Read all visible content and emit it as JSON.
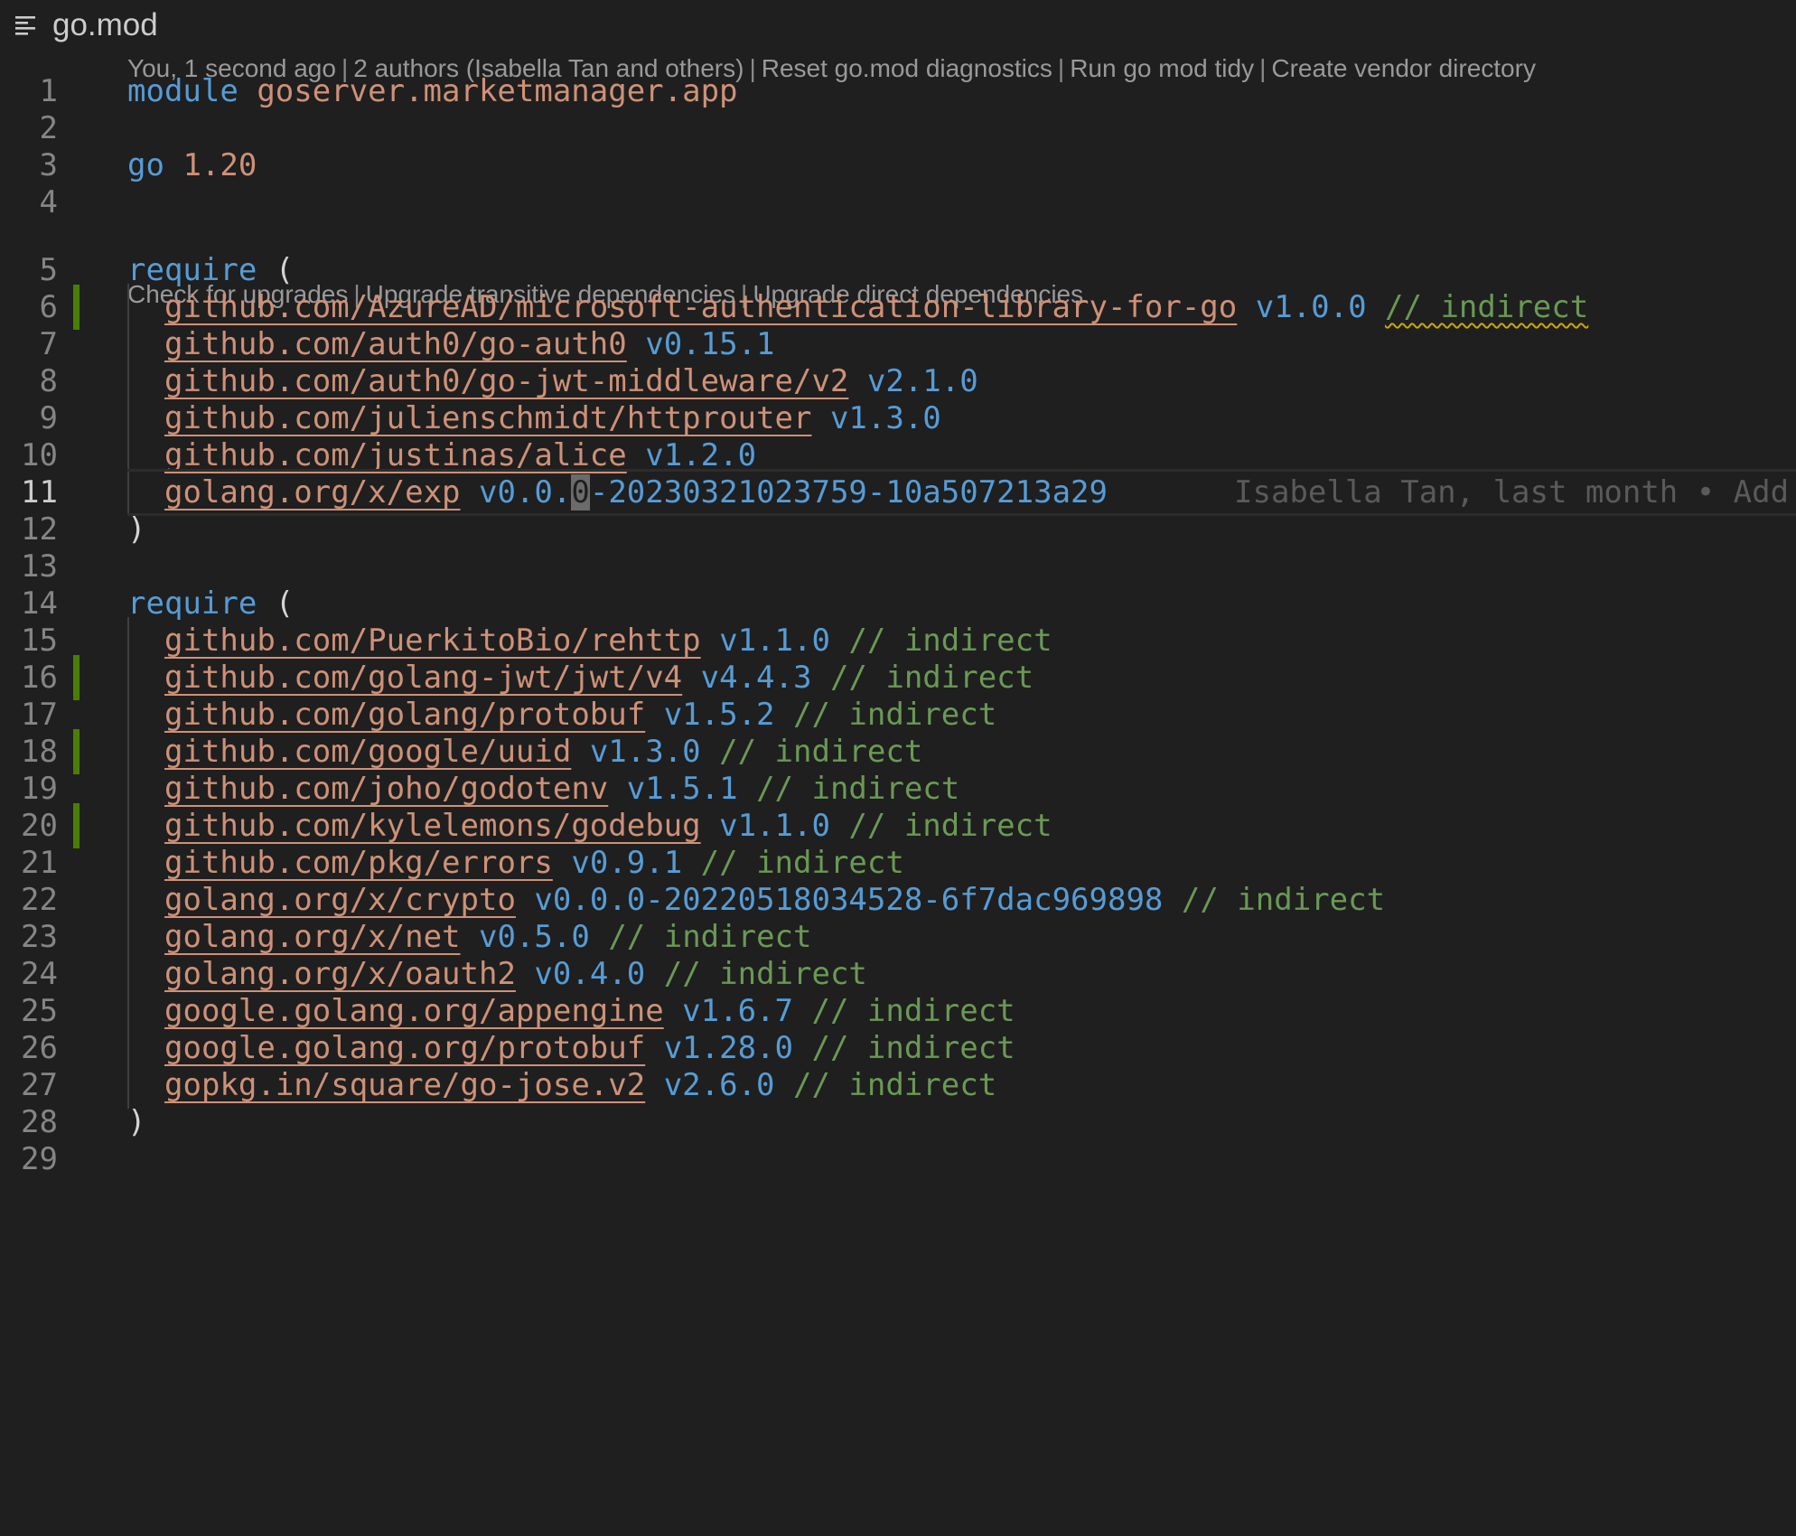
{
  "breadcrumb": {
    "icon": "list-outline-icon",
    "title": "go.mod"
  },
  "codelens": {
    "top": {
      "author": "You, 1 second ago",
      "authors": "2 authors (Isabella Tan and others)",
      "actions": [
        "Reset go.mod diagnostics",
        "Run go mod tidy",
        "Create vendor directory"
      ]
    },
    "require": {
      "actions": [
        "Check for upgrades",
        "Upgrade transitive dependencies",
        "Upgrade direct dependencies"
      ]
    }
  },
  "file": {
    "module_keyword": "module",
    "module_name": "goserver.marketmanager.app",
    "go_keyword": "go",
    "go_version": "1.20",
    "require_keyword": "require",
    "open_paren": "(",
    "close_paren": ")",
    "comment_marker": "//",
    "indirect_word": "indirect",
    "current_line": 11,
    "blame": "Isabella Tan, last month • Add",
    "require_block_1": [
      {
        "line": 6,
        "path": "github.com/AzureAD/microsoft-authentication-library-for-go",
        "version": "v1.0.0",
        "comment": "// indirect",
        "changed": true,
        "warning": true
      },
      {
        "line": 7,
        "path": "github.com/auth0/go-auth0",
        "version": "v0.15.1",
        "comment": "",
        "changed": false
      },
      {
        "line": 8,
        "path": "github.com/auth0/go-jwt-middleware/v2",
        "version": "v2.1.0",
        "comment": "",
        "changed": false
      },
      {
        "line": 9,
        "path": "github.com/julienschmidt/httprouter",
        "version": "v1.3.0",
        "comment": "",
        "changed": false
      },
      {
        "line": 10,
        "path": "github.com/justinas/alice",
        "version": "v1.2.0",
        "comment": "",
        "changed": false
      },
      {
        "line": 11,
        "path": "golang.org/x/exp",
        "version": "v0.0.0-20230321023759-10a507213a29",
        "comment": "",
        "changed": false
      }
    ],
    "require_block_2": [
      {
        "line": 15,
        "path": "github.com/PuerkitoBio/rehttp",
        "version": "v1.1.0",
        "comment": "// indirect",
        "changed": false
      },
      {
        "line": 16,
        "path": "github.com/golang-jwt/jwt/v4",
        "version": "v4.4.3",
        "comment": "// indirect",
        "changed": true
      },
      {
        "line": 17,
        "path": "github.com/golang/protobuf",
        "version": "v1.5.2",
        "comment": "// indirect",
        "changed": false
      },
      {
        "line": 18,
        "path": "github.com/google/uuid",
        "version": "v1.3.0",
        "comment": "// indirect",
        "changed": true
      },
      {
        "line": 19,
        "path": "github.com/joho/godotenv",
        "version": "v1.5.1",
        "comment": "// indirect",
        "changed": false
      },
      {
        "line": 20,
        "path": "github.com/kylelemons/godebug",
        "version": "v1.1.0",
        "comment": "// indirect",
        "changed": true
      },
      {
        "line": 21,
        "path": "github.com/pkg/errors",
        "version": "v0.9.1",
        "comment": "// indirect",
        "changed": false
      },
      {
        "line": 22,
        "path": "golang.org/x/crypto",
        "version": "v0.0.0-20220518034528-6f7dac969898",
        "comment": "// indirect",
        "changed": false
      },
      {
        "line": 23,
        "path": "golang.org/x/net",
        "version": "v0.5.0",
        "comment": "// indirect",
        "changed": false
      },
      {
        "line": 24,
        "path": "golang.org/x/oauth2",
        "version": "v0.4.0",
        "comment": "// indirect",
        "changed": false
      },
      {
        "line": 25,
        "path": "google.golang.org/appengine",
        "version": "v1.6.7",
        "comment": "// indirect",
        "changed": false
      },
      {
        "line": 26,
        "path": "google.golang.org/protobuf",
        "version": "v1.28.0",
        "comment": "// indirect",
        "changed": false
      },
      {
        "line": 27,
        "path": "gopkg.in/square/go-jose.v2",
        "version": "v2.6.0",
        "comment": "// indirect",
        "changed": false
      }
    ],
    "line_numbers": [
      "1",
      "2",
      "3",
      "4",
      "5",
      "6",
      "7",
      "8",
      "9",
      "10",
      "11",
      "12",
      "13",
      "14",
      "15",
      "16",
      "17",
      "18",
      "19",
      "20",
      "21",
      "22",
      "23",
      "24",
      "25",
      "26",
      "27",
      "28",
      "29"
    ]
  },
  "colors": {
    "background": "#1f1f1f",
    "keyword": "#569cd6",
    "string": "#ce9178",
    "comment": "#6a9955",
    "gutter_added": "#487e02",
    "warning": "#cca700"
  }
}
